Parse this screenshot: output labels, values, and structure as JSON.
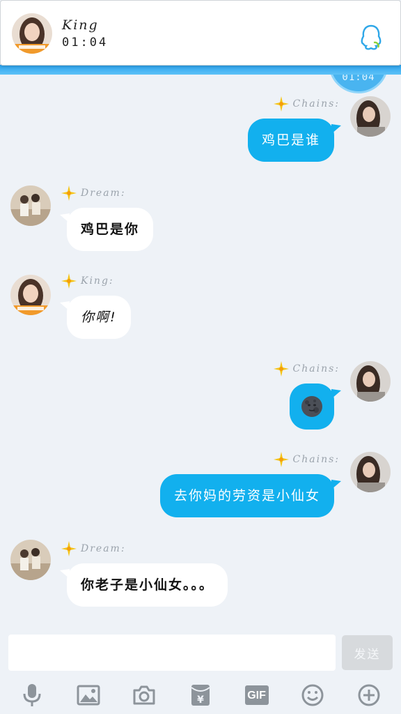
{
  "notification": {
    "sender": "King",
    "time": "01:04",
    "app_icon": "qq-penguin-icon"
  },
  "time_bubble": "01:04",
  "messages": [
    {
      "side": "right",
      "nick": "Chains:",
      "text": "鸡巴是谁"
    },
    {
      "side": "left",
      "nick": "Dream:",
      "text": "鸡巴是你"
    },
    {
      "side": "left",
      "nick": "King:",
      "text": "你啊!"
    },
    {
      "side": "right",
      "nick": "Chains:",
      "text": "🌚"
    },
    {
      "side": "right",
      "nick": "Chains:",
      "text": "去你妈的劳资是小仙女"
    },
    {
      "side": "left",
      "nick": "Dream:",
      "text": "你老子是小仙女。。。"
    }
  ],
  "input": {
    "value": "",
    "send_label": "发送"
  },
  "toolbar_icons": [
    "microphone-icon",
    "image-icon",
    "camera-icon",
    "red-packet-icon",
    "gif-icon",
    "emoji-icon",
    "plus-icon"
  ],
  "toolbar_gif_label": "GIF",
  "colors": {
    "accent": "#12b0ee",
    "background": "#eef2f7",
    "send_disabled": "#d7dadd"
  }
}
